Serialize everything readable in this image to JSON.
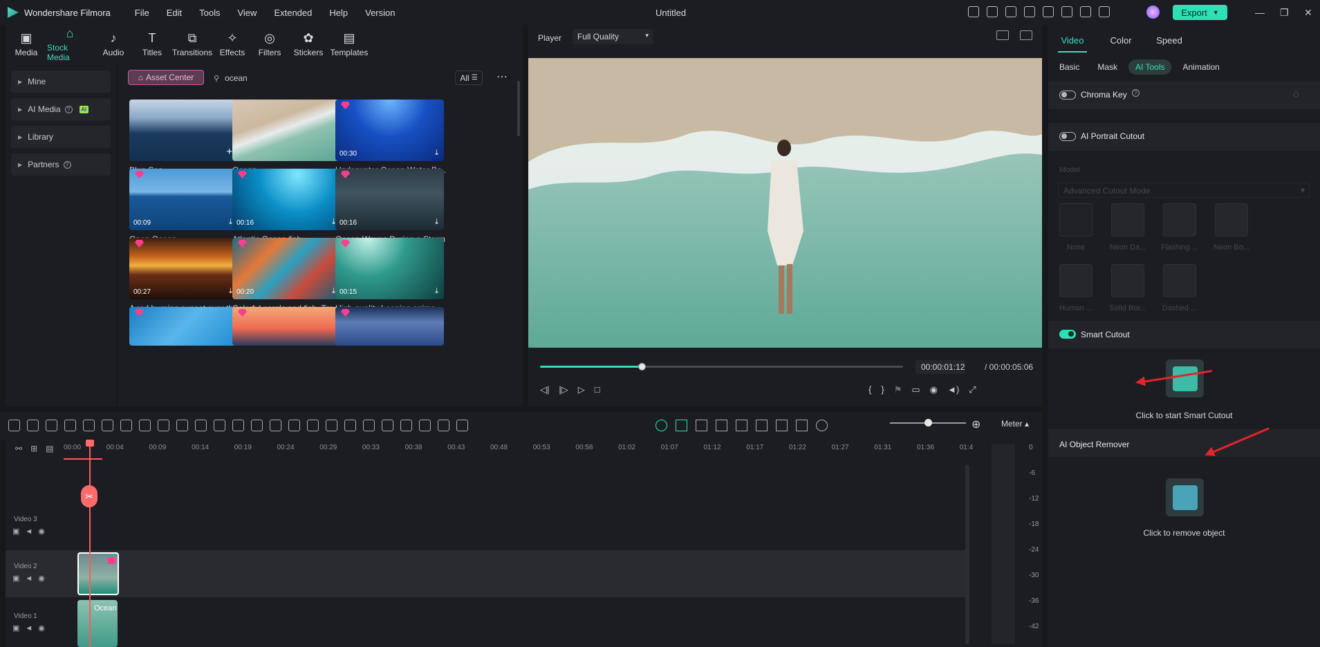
{
  "app": {
    "name": "Wondershare Filmora",
    "window_title": "Untitled",
    "export_label": "Export"
  },
  "menu": [
    "File",
    "Edit",
    "Tools",
    "View",
    "Extended",
    "Help",
    "Version"
  ],
  "media_toolbar": [
    "Media",
    "Stock Media",
    "Audio",
    "Titles",
    "Transitions",
    "Effects",
    "Filters",
    "Stickers",
    "Templates"
  ],
  "sidebar": [
    "Mine",
    "AI Media",
    "Library",
    "Partners"
  ],
  "ai_badge": "AI",
  "browser": {
    "asset_center": "Asset Center",
    "search_value": "ocean",
    "filter": "All"
  },
  "cards": [
    {
      "label": "Blue Sea",
      "duration": ""
    },
    {
      "label": "Ocean",
      "duration": ""
    },
    {
      "label": "Underwater Ocean Water Ba...",
      "duration": "00:30"
    },
    {
      "label": "Open Ocean",
      "duration": "00:09"
    },
    {
      "label": "Atlantic Ocean fish",
      "duration": "00:16"
    },
    {
      "label": "Ocean Waves During a Storm",
      "duration": "00:16"
    },
    {
      "label": "A red burning sunset over th...",
      "duration": "00:27"
    },
    {
      "label": "Colorful corals and fish. Tro...",
      "duration": "00:20"
    },
    {
      "label": "High quality Looping anima...",
      "duration": "00:15"
    },
    {
      "label": "",
      "duration": ""
    },
    {
      "label": "",
      "duration": ""
    },
    {
      "label": "",
      "duration": ""
    }
  ],
  "player": {
    "label": "Player",
    "quality": "Full Quality",
    "current_time": "00:00:01:12",
    "total_time": "/  00:00:05:06",
    "progress": 0.28
  },
  "timeline": {
    "meter_label": "Meter",
    "ruler": [
      "00:00",
      "00:04",
      "00:09",
      "00:14",
      "00:19",
      "00:24",
      "00:29",
      "00:33",
      "00:38",
      "00:43",
      "00:48",
      "00:53",
      "00:58",
      "01:02",
      "01:07",
      "01:12",
      "01:17",
      "01:22",
      "01:27",
      "01:31",
      "01:36",
      "01:4"
    ],
    "tracks": [
      "Video 3",
      "Video 2",
      "Video 1"
    ],
    "clip_video1_label": "Ocean",
    "vu_labels": [
      "0",
      "-6",
      "-12",
      "-18",
      "-24",
      "-30",
      "-36",
      "-42"
    ]
  },
  "right_panel": {
    "tabs": [
      "Video",
      "Color",
      "Speed"
    ],
    "subtabs": [
      "Basic",
      "Mask",
      "AI Tools",
      "Animation"
    ],
    "chroma_key": "Chroma Key",
    "ai_portrait": "AI Portrait Cutout",
    "model_label": "Model",
    "model_value": "Advanced Cutout Mode",
    "portrait_fx": [
      "None",
      "Neon Da...",
      "Flashing ...",
      "Neon Bo...",
      "Human ...",
      "Solid Bor...",
      "Dashed ..."
    ],
    "smart_cutout": "Smart Cutout",
    "smart_cutout_hint": "Click to start Smart Cutout",
    "object_remover": "AI Object Remover",
    "object_remover_hint": "Click to remove object"
  },
  "colors": {
    "accent": "#2ee0b6",
    "annotation_arrow": "#e0252b"
  }
}
